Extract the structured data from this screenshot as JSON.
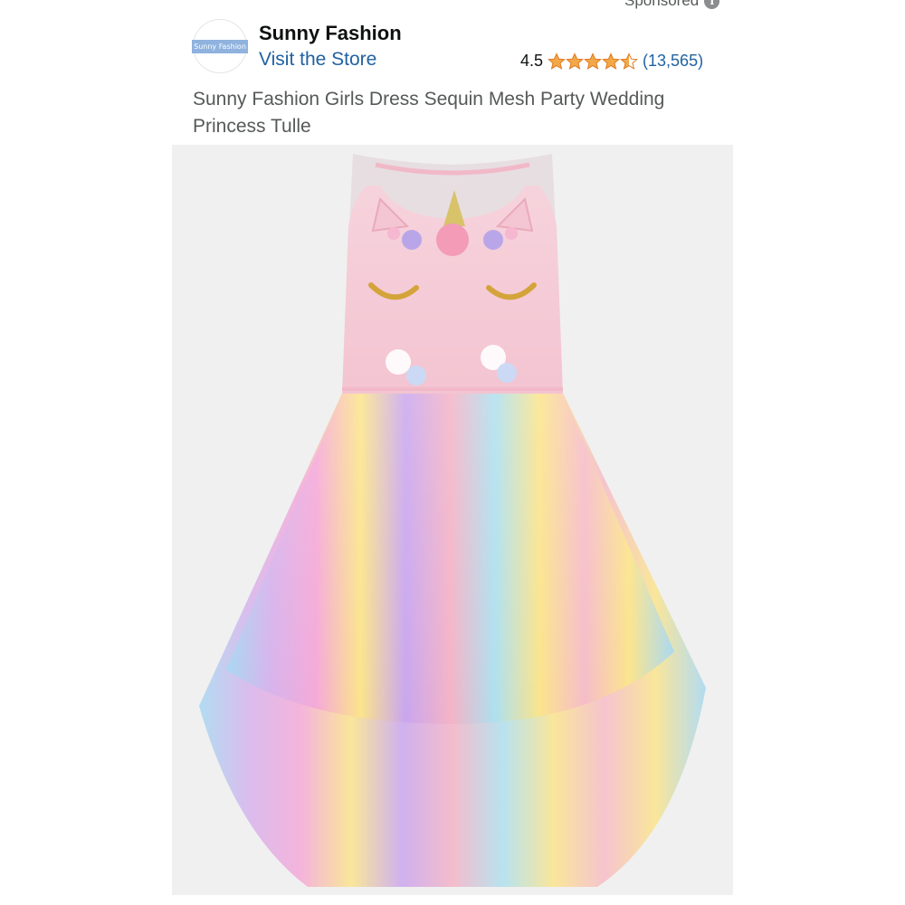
{
  "sponsored": {
    "label": "Sponsored",
    "info_icon": "info-icon"
  },
  "brand": {
    "logo_text": "Sunny Fashion",
    "name": "Sunny Fashion",
    "store_link": "Visit the Store"
  },
  "rating": {
    "score": "4.5",
    "stars": 4.5,
    "count": "(13,565)",
    "star_color": "#f3a847"
  },
  "product": {
    "title": "Sunny Fashion Girls Dress Sequin Mesh Party Wedding Princess Tulle",
    "image": "rainbow unicorn tulle dress"
  },
  "colors": {
    "link": "#2162a1",
    "text": "#0f1111",
    "muted": "#565959",
    "image_bg": "#f0f0f0"
  }
}
